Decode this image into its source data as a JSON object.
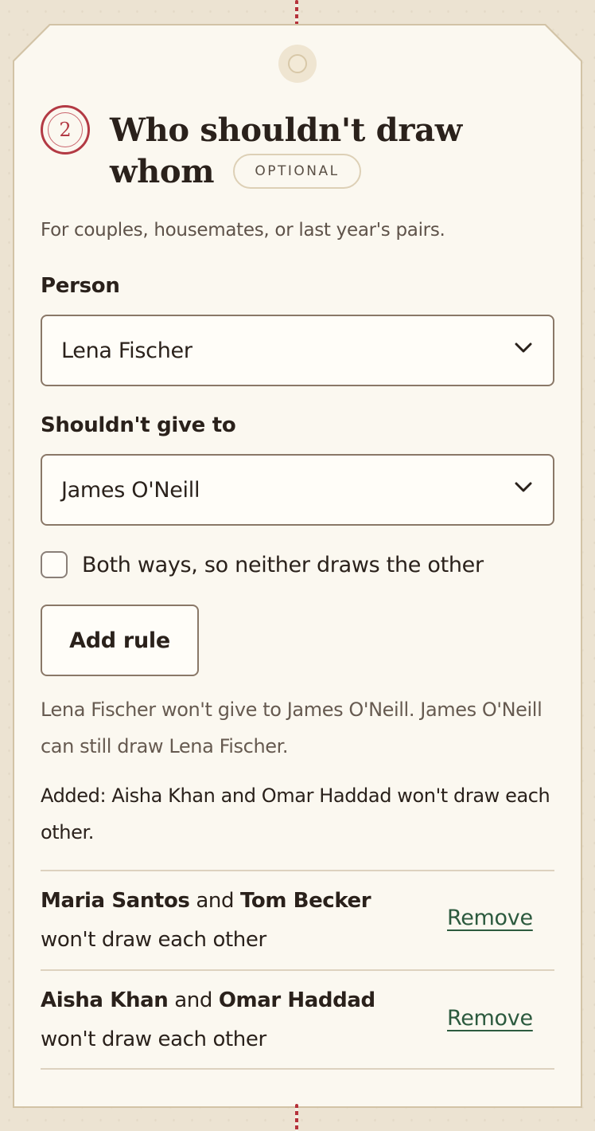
{
  "section": {
    "step_number": "2",
    "title": "Who shouldn't draw whom",
    "badge": "OPTIONAL",
    "description": "For couples, housemates, or last year's pairs."
  },
  "form": {
    "person_label": "Person",
    "person_value": "Lena Fischer",
    "recipient_label": "Shouldn't give to",
    "recipient_value": "James O'Neill",
    "both_ways_label": "Both ways, so neither draws the other",
    "both_ways_checked": false,
    "add_button_label": "Add rule"
  },
  "hint_text": "Lena Fischer won't give to James O'Neill. James O'Neill can still draw Lena Fischer.",
  "added_message": "Added: Aisha Khan and Omar Haddad won't draw each other.",
  "rules": [
    {
      "person_a": "Maria Santos",
      "connector": "and",
      "person_b": "Tom Becker",
      "suffix": "won't draw each other",
      "remove_label": "Remove"
    },
    {
      "person_a": "Aisha Khan",
      "connector": "and",
      "person_b": "Omar Haddad",
      "suffix": "won't draw each other",
      "remove_label": "Remove"
    }
  ],
  "icons": {
    "person_select": "chevron-down-icon",
    "recipient_select": "chevron-down-icon"
  },
  "colors": {
    "accent_red": "#b33a44",
    "link_green": "#2c5a3e",
    "card_bg": "#fbf8f0",
    "page_bg": "#ece3d2"
  }
}
